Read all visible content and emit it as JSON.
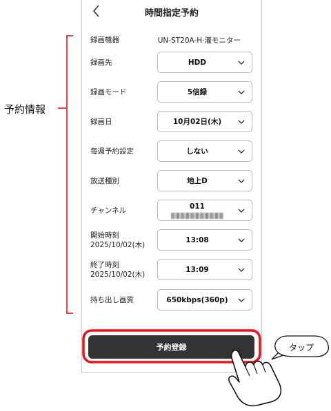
{
  "screen": {
    "title": "時間指定予約",
    "back_icon": "chevron-left-icon"
  },
  "form": {
    "device": {
      "label": "録画機器",
      "value": "UN-ST20A-H·灌モニター"
    },
    "rows": [
      {
        "label": "録画先",
        "value": "HDD"
      },
      {
        "label": "録画モード",
        "value": "5倍録"
      },
      {
        "label": "録画日",
        "value": "10月02日(木)"
      },
      {
        "label": "毎週予約設定",
        "value": "しない"
      },
      {
        "label": "放送種別",
        "value": "地上D"
      },
      {
        "label": "チャンネル",
        "value": "011"
      },
      {
        "label": "開始時刻",
        "sublabel": "2025/10/02(木)",
        "value": "13:08"
      },
      {
        "label": "終了時刻",
        "sublabel": "2025/10/02(木)",
        "value": "13:09"
      },
      {
        "label": "持ち出し画質",
        "value": "650kbps(360p)"
      }
    ],
    "dropdown_icon": "chevron-down-icon"
  },
  "reserve_button": {
    "label": "予約登録"
  },
  "annotations": {
    "bracket_label": "予約情報",
    "callout_label": "タップ",
    "highlight_color": "#e8141c"
  }
}
